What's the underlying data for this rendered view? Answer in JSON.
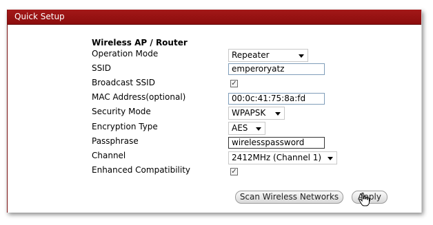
{
  "window": {
    "title": "Quick Setup"
  },
  "section": {
    "heading": "Wireless AP / Router"
  },
  "fields": {
    "operation_mode": {
      "label": "Operation Mode",
      "value": "Repeater"
    },
    "ssid": {
      "label": "SSID",
      "value": "emperoryatz"
    },
    "broadcast_ssid": {
      "label": "Broadcast SSID",
      "checked": true,
      "mark": "✓"
    },
    "mac_address": {
      "label": "MAC Address(optional)",
      "value": "00:0c:41:75:8a:fd"
    },
    "security_mode": {
      "label": "Security Mode",
      "value": "WPAPSK"
    },
    "encryption_type": {
      "label": "Encryption Type",
      "value": "AES"
    },
    "passphrase": {
      "label": "Passphrase",
      "value": "wirelesspassword"
    },
    "channel": {
      "label": "Channel",
      "value": "2412MHz (Channel 1)"
    },
    "enhanced_compatibility": {
      "label": "Enhanced Compatibility",
      "checked": true,
      "mark": "✓"
    }
  },
  "buttons": {
    "scan": "Scan Wireless Networks",
    "apply": "Apply"
  },
  "colors": {
    "titlebar": "#9a1212",
    "title_text": "#ffffff"
  },
  "icons": {
    "cursor": "hand-pointer-icon",
    "dropdown": "chevron-down-icon"
  }
}
